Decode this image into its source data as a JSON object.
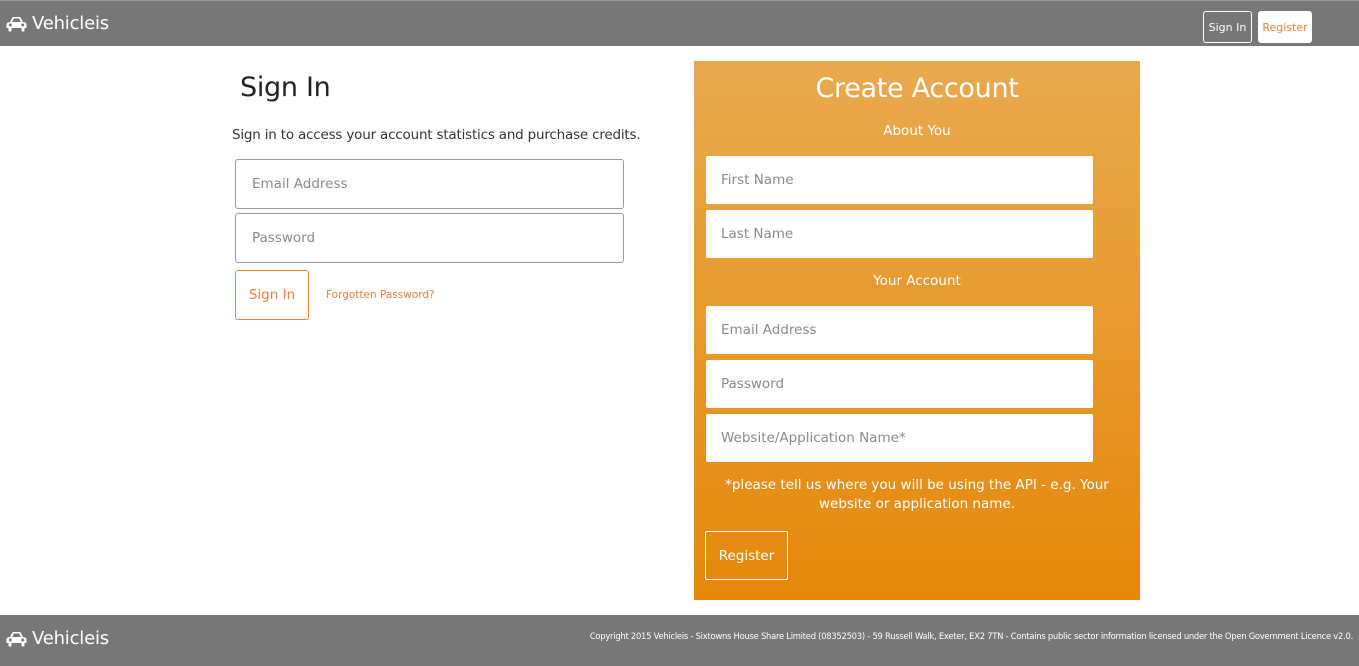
{
  "header": {
    "brand_name": "Vehicleis",
    "brand_icon": "car-icon",
    "signin_label": "Sign In",
    "register_label": "Register"
  },
  "signin": {
    "title": "Sign In",
    "description": "Sign in to access your account statistics and purchase credits.",
    "email_placeholder": "Email Address",
    "password_placeholder": "Password",
    "button_label": "Sign In",
    "forgot_label": "Forgotten Password?"
  },
  "create_account": {
    "title": "Create Account",
    "about_heading": "About You",
    "first_name_placeholder": "First Name",
    "last_name_placeholder": "Last Name",
    "account_heading": "Your Account",
    "email_placeholder": "Email Address",
    "password_placeholder": "Password",
    "website_placeholder": "Website/Application Name*",
    "note": "*please tell us where you will be using the API - e.g. Your website or application name.",
    "button_label": "Register"
  },
  "footer": {
    "brand_name": "Vehicleis",
    "brand_icon": "car-icon",
    "copyright": "Copyright 2015 Vehicleis - Sixtowns House Share Limited (08352503) - 59 Russell Walk, Exeter, EX2 7TN - Contains public sector information licensed under the Open Government Licence v2.0."
  },
  "colors": {
    "nav_background": "#777777",
    "accent": "#e8823a",
    "panel_top": "#e8a94e",
    "panel_bottom": "#e5880a"
  }
}
